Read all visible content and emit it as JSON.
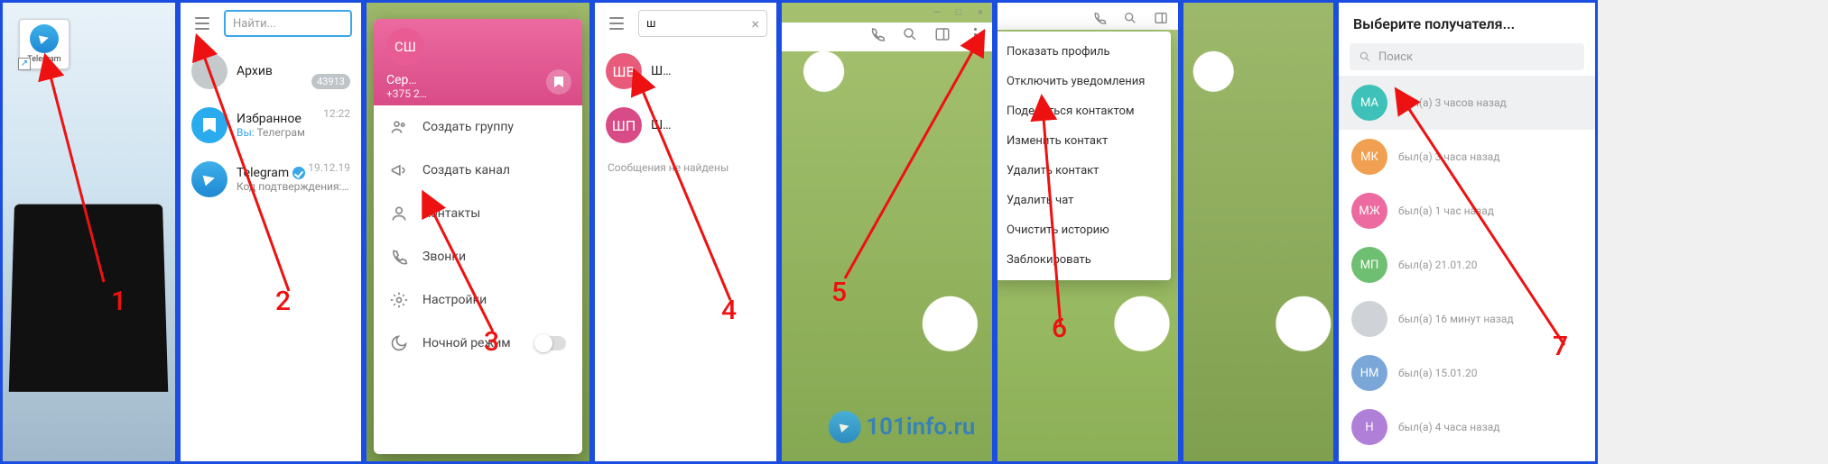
{
  "panel1": {
    "icon_label": "Telegram",
    "step": "1"
  },
  "panel2": {
    "search_placeholder": "Найти...",
    "archive_label": "Архив",
    "archive_badge": "43913",
    "saved": {
      "title": "Избранное",
      "subtitle_prefix": "Вы:",
      "subtitle": "Телеграм",
      "time": "12:22"
    },
    "telegram": {
      "title": "Telegram",
      "subtitle": "Код подтверждения: 1…",
      "time": "19.12.19"
    },
    "step": "2"
  },
  "panel3": {
    "profile": {
      "initials": "СШ",
      "name": "Сер…",
      "phone": "+375 2…"
    },
    "items": [
      "Создать группу",
      "Создать канал",
      "Контакты",
      "Звонки",
      "Настройки",
      "Ночной режим"
    ],
    "step": "3"
  },
  "panel4": {
    "query": "ш",
    "results": [
      {
        "avatar": "ШВ",
        "title": "Ш…"
      },
      {
        "avatar": "ШП",
        "title": "Ш…"
      }
    ],
    "no_results": "Сообщения не найдены",
    "watermark": "101info.ru",
    "step": "4"
  },
  "panel5": {
    "step": "5"
  },
  "panel6": {
    "items": [
      "Показать профиль",
      "Отключить уведомления",
      "Поделиться контактом",
      "Изменить контакт",
      "Удалить контакт",
      "Удалить чат",
      "Очистить историю",
      "Заблокировать"
    ],
    "step": "6"
  },
  "panel7": {
    "title": "Выберите получателя...",
    "search_placeholder": "Поиск",
    "contacts": [
      {
        "initials": "МА",
        "status": "был(а) 3 часов назад",
        "color": "c-teal",
        "sel": true
      },
      {
        "initials": "МК",
        "status": "был(а) 3 часа назад",
        "color": "c-orange"
      },
      {
        "initials": "МЖ",
        "status": "был(а) 1 час назад",
        "color": "c-pink"
      },
      {
        "initials": "МП",
        "status": "был(а) 21.01.20",
        "color": "c-green"
      },
      {
        "initials": "",
        "status": "был(а) 16 минут назад",
        "color": "c-grey"
      },
      {
        "initials": "НМ",
        "status": "был(а) 15.01.20",
        "color": "c-blue"
      },
      {
        "initials": "Н",
        "status": "был(а) 4 часа назад",
        "color": "c-purple"
      }
    ],
    "step": "7"
  }
}
